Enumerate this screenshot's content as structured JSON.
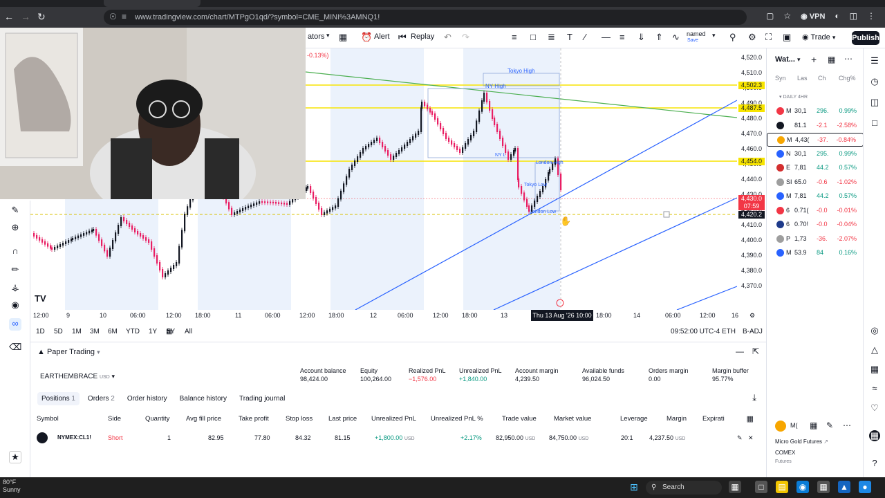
{
  "browser": {
    "url": "www.tradingview.com/chart/MTPgO1qd/?symbol=CME_MINI%3AMNQ1!",
    "vpn_label": "VPN"
  },
  "toolbar": {
    "indicators_label": "ators",
    "alert_label": "Alert",
    "replay_label": "Replay",
    "layout_name": "named",
    "layout_sub": "Save",
    "trade_label": "Trade",
    "publish_label": "Publish"
  },
  "chart": {
    "change_label": "-0.13%)",
    "annotations": {
      "tokyo_high": "Tokyo High",
      "ny_high": "NY High",
      "ny_low": "NY L",
      "london_high": "London High",
      "tokyo_low": "Tokyo Low",
      "london_low": "London Low"
    },
    "price_ticks": [
      "4,520.0",
      "4,510.0",
      "4,500.0",
      "4,490.0",
      "4,480.0",
      "4,470.0",
      "4,460.0",
      "4,450.0",
      "4,440.0",
      "4,430.0",
      "4,420.0",
      "4,410.0",
      "4,400.0",
      "4,390.0",
      "4,380.0",
      "4,370.0"
    ],
    "price_badges": {
      "b1": "4,502.3",
      "b2": "4,487.5",
      "b3": "4,454.0",
      "last_price": "4,430.0",
      "countdown": "07:59",
      "crosshair_price": "4,420.2"
    },
    "time_ticks": [
      "12:00",
      "9",
      "10",
      "06:00",
      "12:00",
      "18:00",
      "11",
      "06:00",
      "12:00",
      "18:00",
      "12",
      "06:00",
      "12:00",
      "18:00",
      "13",
      "18:00",
      "14",
      "06:00",
      "12:00",
      "16"
    ],
    "current_time": "Thu 13 Aug '26",
    "current_clock": "10:00"
  },
  "rangebar": {
    "ranges": [
      "1D",
      "5D",
      "1M",
      "3M",
      "6M",
      "YTD",
      "1Y",
      "5Y",
      "All"
    ],
    "clock": "09:52:00 UTC-4",
    "session": "ETH",
    "adj": "B-ADJ"
  },
  "panel": {
    "title": "Paper Trading",
    "account_name": "EARTHEMBRACE",
    "account_currency": "USD",
    "metrics": [
      {
        "label": "Account balance",
        "value": "98,424.00"
      },
      {
        "label": "Equity",
        "value": "100,264.00"
      },
      {
        "label": "Realized PnL",
        "value": "−1,576.00"
      },
      {
        "label": "Unrealized PnL",
        "value": "+1,840.00"
      },
      {
        "label": "Account margin",
        "value": "4,239.50"
      },
      {
        "label": "Available funds",
        "value": "96,024.50"
      },
      {
        "label": "Orders margin",
        "value": "0.00"
      },
      {
        "label": "Margin buffer",
        "value": "95.77%"
      }
    ],
    "tabs": [
      {
        "label": "Positions",
        "count": "1"
      },
      {
        "label": "Orders",
        "count": "2"
      },
      {
        "label": "Order history",
        "count": ""
      },
      {
        "label": "Balance history",
        "count": ""
      },
      {
        "label": "Trading journal",
        "count": ""
      }
    ],
    "columns": [
      "Symbol",
      "Side",
      "Quantity",
      "Avg fill price",
      "Take profit",
      "Stop loss",
      "Last price",
      "Unrealized PnL",
      "Unrealized PnL %",
      "Trade value",
      "Market value",
      "Leverage",
      "Margin",
      "Expirati"
    ],
    "position": {
      "symbol": "NYMEX:CL1!",
      "side": "Short",
      "quantity": "1",
      "avg_fill": "82.95",
      "take_profit": "77.80",
      "stop_loss": "84.32",
      "last_price": "81.15",
      "unrealized_pnl": "+1,800.00",
      "unrealized_pct": "+2.17%",
      "trade_value": "82,950.00",
      "market_value": "84,750.00",
      "leverage": "20:1",
      "margin": "4,237.50",
      "currency": "USD"
    }
  },
  "watchlist": {
    "title": "Wat...",
    "columns": [
      "Syn",
      "Las",
      "Ch",
      "Chg%"
    ],
    "group": "DAILY 4HR",
    "rows": [
      {
        "sym": "M",
        "last": "30,1",
        "chg": "296.",
        "pct": "0.99%",
        "color": "#f23645",
        "up": true
      },
      {
        "sym": "",
        "last": "81.1",
        "chg": "-2.1",
        "pct": "-2.58%",
        "color": "#131722",
        "up": false
      },
      {
        "sym": "M",
        "last": "4,43(",
        "chg": "-37.",
        "pct": "-0.84%",
        "color": "#f7a600",
        "up": false
      },
      {
        "sym": "N",
        "last": "30,1",
        "chg": "295.",
        "pct": "0.99%",
        "color": "#2962ff",
        "up": true
      },
      {
        "sym": "E",
        "last": "7,81",
        "chg": "44.2",
        "pct": "0.57%",
        "color": "#d32f2f",
        "up": true
      },
      {
        "sym": "SI",
        "last": "65.0",
        "chg": "-0.6",
        "pct": "-1.02%",
        "color": "#9e9e9e",
        "up": false
      },
      {
        "sym": "M",
        "last": "7,81",
        "chg": "44.2",
        "pct": "0.57%",
        "color": "#2962ff",
        "up": true
      },
      {
        "sym": "6",
        "last": "0.71(",
        "chg": "-0.0",
        "pct": "-0.01%",
        "color": "#f23645",
        "up": false
      },
      {
        "sym": "6",
        "last": "0.70!",
        "chg": "-0.0",
        "pct": "-0.04%",
        "color": "#1e3a8a",
        "up": false
      },
      {
        "sym": "P",
        "last": "1,73",
        "chg": "-36.",
        "pct": "-2.07%",
        "color": "#9e9e9e",
        "up": false
      },
      {
        "sym": "M",
        "last": "53.9",
        "chg": "84",
        "pct": "0.16%",
        "color": "#2962ff",
        "up": true
      }
    ],
    "details": {
      "name": "Micro Gold Futures",
      "exchange": "COMEX",
      "type": "Futures",
      "short_sym": "M("
    }
  },
  "taskbar": {
    "temp": "80°F",
    "weather": "Sunny",
    "search_label": "Search"
  }
}
